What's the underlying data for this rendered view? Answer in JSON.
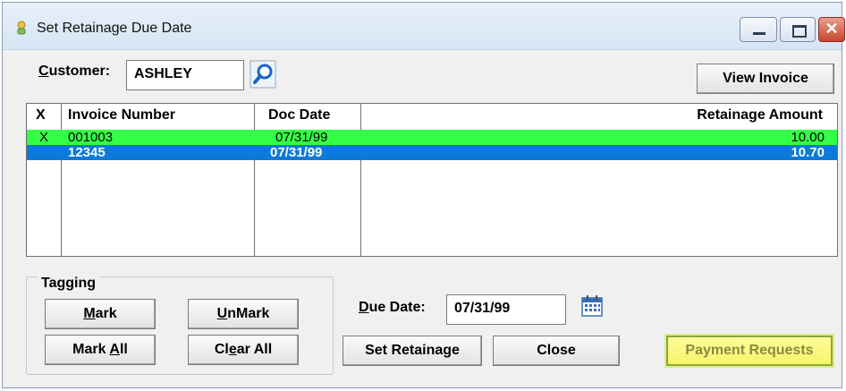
{
  "window": {
    "title": "Set Retainage Due Date"
  },
  "customer": {
    "label_u": "C",
    "label_rest": "ustomer:",
    "value": "ASHLEY"
  },
  "actions": {
    "view_invoice": "View Invoice"
  },
  "grid": {
    "headers": [
      "X",
      "Invoice Number",
      "Doc Date",
      "Retainage Amount"
    ],
    "rows": [
      {
        "x": "X",
        "invoice": "001003",
        "doc_date": "07/31/99",
        "amount": "10.00"
      },
      {
        "x": "",
        "invoice": "12345",
        "doc_date": "07/31/99",
        "amount": "10.70"
      }
    ]
  },
  "tagging": {
    "title": "Tagging",
    "mark_u": "M",
    "mark_rest": "ark",
    "unmark_u": "U",
    "unmark_rest": "nMark",
    "markall_pre": "Mark ",
    "markall_u": "A",
    "markall_rest": "ll",
    "clearall_pre": "Cl",
    "clearall_u": "e",
    "clearall_rest": "ar All"
  },
  "due_date": {
    "label_u": "D",
    "label_rest": "ue Date:",
    "value": "07/31/99"
  },
  "bottom_buttons": {
    "set_retainage": "Set Retainage",
    "close": "Close",
    "payment_requests": "Payment Requests"
  },
  "colors": {
    "green_row": "#33ff46",
    "blue_row": "#0b7ad8",
    "highlight_button": "#f6f46a"
  }
}
